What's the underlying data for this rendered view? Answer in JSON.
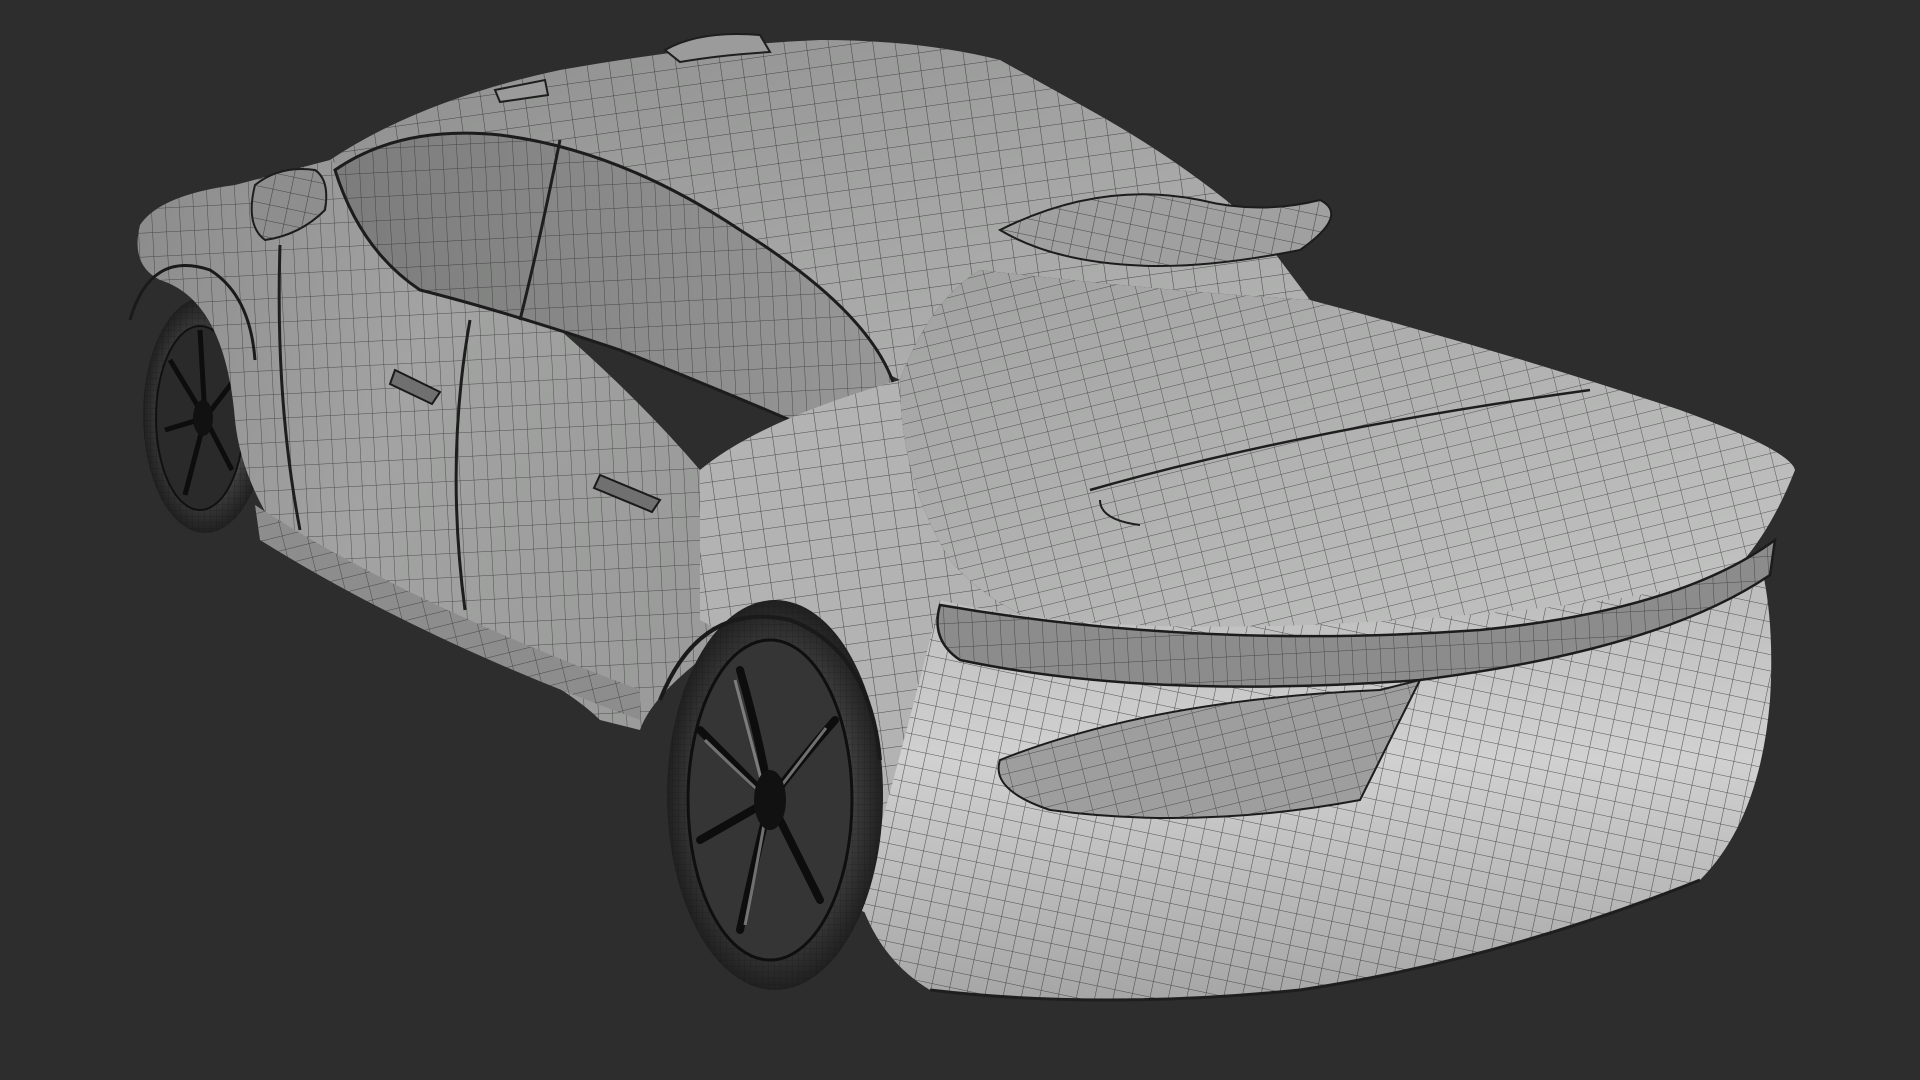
{
  "scene": {
    "subject": "car-wireframe-render",
    "colors": {
      "background": "#2d2d2d",
      "body_light": "#c9c9c9",
      "body_mid": "#a9aaa9",
      "body_dark": "#7e807f",
      "wire": "#262626",
      "tire": "#1b1b1b",
      "rim": "#8a8a8a"
    }
  }
}
